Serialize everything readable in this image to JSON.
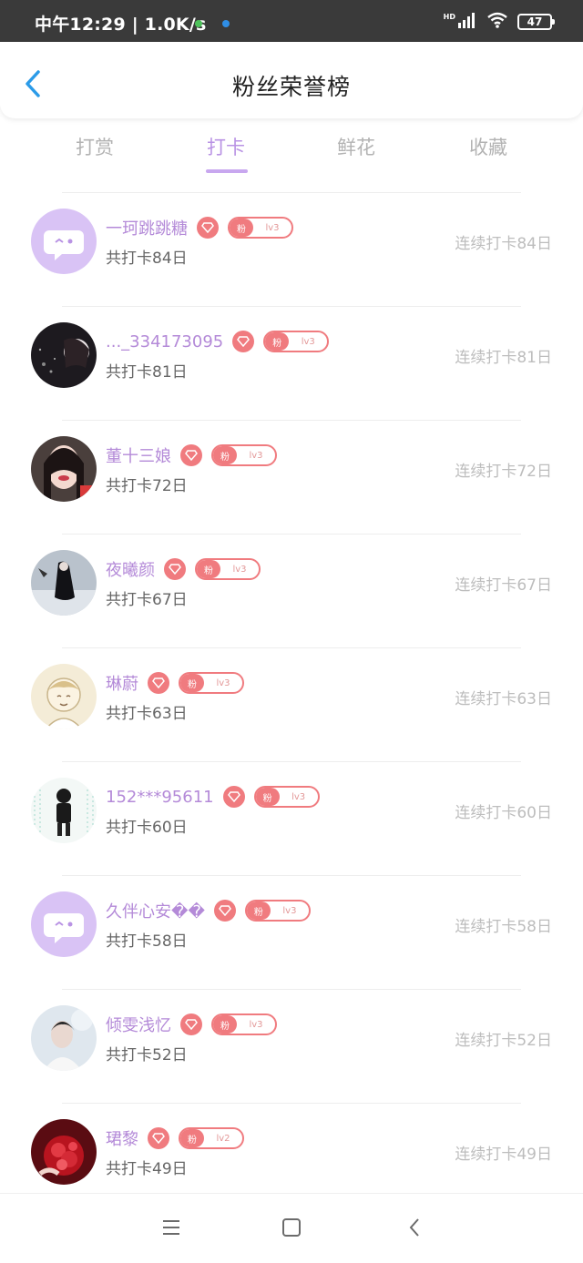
{
  "status_bar": {
    "time_speed": "中午12:29 | 1.0K/s",
    "network_label": "HD",
    "battery": "47",
    "icons": [
      "notification-dot-icon",
      "signal-icon",
      "wifi-icon",
      "battery-icon"
    ]
  },
  "header": {
    "title": "粉丝荣誉榜",
    "back_icon": "chevron-left-icon"
  },
  "tabs": [
    {
      "label": "打赏",
      "active": false
    },
    {
      "label": "打卡",
      "active": true
    },
    {
      "label": "鲜花",
      "active": false
    },
    {
      "label": "收藏",
      "active": false
    }
  ],
  "colors": {
    "accent": "#b993e4",
    "name": "#b48ad8",
    "badge": "#f07b7f",
    "muted": "#bdbdbd"
  },
  "fans": [
    {
      "name": "一珂跳跳糖",
      "badge_label": "粉",
      "level": "lv3",
      "total": "共打卡84日",
      "streak": "连续打卡84日",
      "avatar": "default"
    },
    {
      "name": "..._334173095",
      "badge_label": "粉",
      "level": "lv3",
      "total": "共打卡81日",
      "streak": "连续打卡81日",
      "avatar": "dark"
    },
    {
      "name": "董十三娘",
      "badge_label": "粉",
      "level": "lv3",
      "total": "共打卡72日",
      "streak": "连续打卡72日",
      "avatar": "girl"
    },
    {
      "name": "夜曦颜",
      "badge_label": "粉",
      "level": "lv3",
      "total": "共打卡67日",
      "streak": "连续打卡67日",
      "avatar": "night"
    },
    {
      "name": "琳蔚",
      "badge_label": "粉",
      "level": "lv3",
      "total": "共打卡63日",
      "streak": "连续打卡63日",
      "avatar": "cartoon"
    },
    {
      "name": "152***95611",
      "badge_label": "粉",
      "level": "lv3",
      "total": "共打卡60日",
      "streak": "连续打卡60日",
      "avatar": "figure"
    },
    {
      "name": "久伴心安��",
      "badge_label": "粉",
      "level": "lv3",
      "total": "共打卡58日",
      "streak": "连续打卡58日",
      "avatar": "default"
    },
    {
      "name": "倾雯浅忆",
      "badge_label": "粉",
      "level": "lv3",
      "total": "共打卡52日",
      "streak": "连续打卡52日",
      "avatar": "light"
    },
    {
      "name": "珺黎",
      "badge_label": "粉",
      "level": "lv2",
      "total": "共打卡49日",
      "streak": "连续打卡49日",
      "avatar": "red"
    }
  ],
  "nav_bar": {
    "icons": [
      "menu-icon",
      "home-icon",
      "back-icon"
    ]
  }
}
